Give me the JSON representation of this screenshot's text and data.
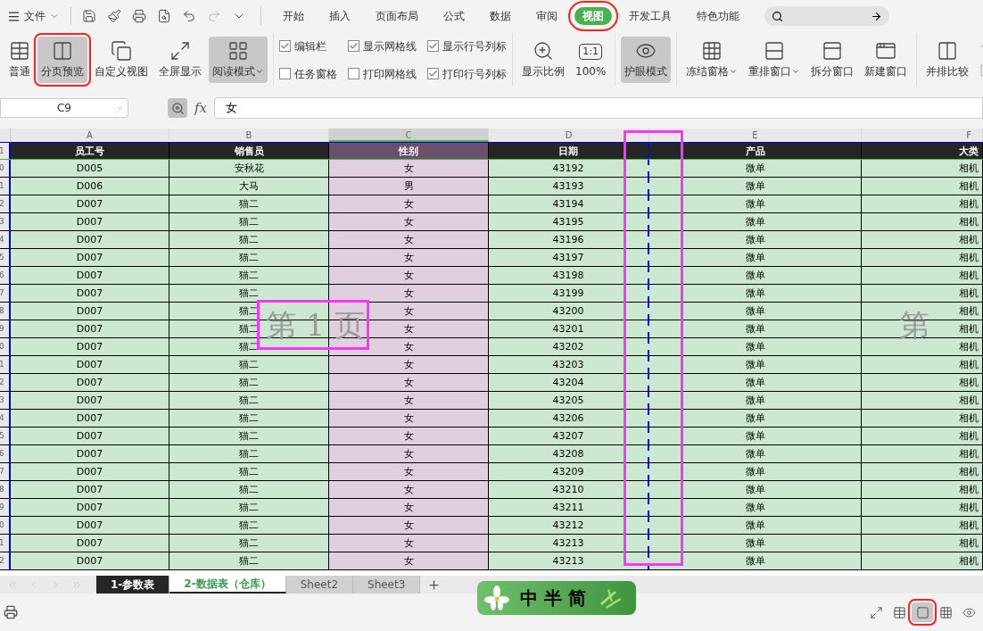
{
  "file_menu": {
    "label": "文件"
  },
  "tabs": [
    {
      "label": "开始",
      "selected": false,
      "annotated": false
    },
    {
      "label": "插入",
      "selected": false,
      "annotated": false
    },
    {
      "label": "页面布局",
      "selected": false,
      "annotated": false
    },
    {
      "label": "公式",
      "selected": false,
      "annotated": false
    },
    {
      "label": "数据",
      "selected": false,
      "annotated": false
    },
    {
      "label": "审阅",
      "selected": false,
      "annotated": false
    },
    {
      "label": "视图",
      "selected": true,
      "annotated": true
    },
    {
      "label": "开发工具",
      "selected": false,
      "annotated": false
    },
    {
      "label": "特色功能",
      "selected": false,
      "annotated": false
    }
  ],
  "ribbon_groups": [
    {
      "items": [
        {
          "kind": "large",
          "label": "普通",
          "pressed": false,
          "annotated": false,
          "dropdown": false
        },
        {
          "kind": "large",
          "label": "分页预览",
          "pressed": true,
          "annotated": true,
          "dropdown": false
        },
        {
          "kind": "large",
          "label": "自定义视图",
          "pressed": false,
          "annotated": false,
          "dropdown": false
        },
        {
          "kind": "large",
          "label": "全屏显示",
          "pressed": false,
          "annotated": false,
          "dropdown": false
        },
        {
          "kind": "large",
          "label": "阅读模式",
          "pressed": true,
          "annotated": false,
          "dropdown": true
        }
      ]
    },
    {
      "items": [
        {
          "kind": "check",
          "label": "编辑栏",
          "checked": true
        },
        {
          "kind": "check",
          "label": "任务窗格",
          "checked": false
        },
        {
          "kind": "check",
          "label": "显示网格线",
          "checked": true
        },
        {
          "kind": "check",
          "label": "打印网格线",
          "checked": false
        },
        {
          "kind": "check",
          "label": "显示行号列标",
          "checked": true
        },
        {
          "kind": "check",
          "label": "打印行号列标",
          "checked": true
        }
      ]
    },
    {
      "items": [
        {
          "kind": "large",
          "label": "显示比例",
          "pressed": false,
          "annotated": false,
          "dropdown": false
        },
        {
          "kind": "large",
          "label": "100%",
          "badge": "1:1",
          "pressed": false,
          "annotated": false,
          "dropdown": false
        }
      ]
    },
    {
      "items": [
        {
          "kind": "large",
          "label": "护眼模式",
          "pressed": true,
          "annotated": false,
          "dropdown": false
        }
      ]
    },
    {
      "items": [
        {
          "kind": "large",
          "label": "冻结窗格",
          "pressed": false,
          "annotated": false,
          "dropdown": true
        },
        {
          "kind": "large",
          "label": "重排窗口",
          "pressed": false,
          "annotated": false,
          "dropdown": true
        },
        {
          "kind": "large",
          "label": "拆分窗口",
          "pressed": false,
          "annotated": false,
          "dropdown": false
        },
        {
          "kind": "large",
          "label": "新建窗口",
          "pressed": false,
          "annotated": false,
          "dropdown": false
        }
      ]
    },
    {
      "items": [
        {
          "kind": "large",
          "label": "并排比较",
          "pressed": false,
          "annotated": false,
          "dropdown": false
        }
      ]
    }
  ],
  "formula_bar": {
    "name_box": "C9",
    "function_label": "fx",
    "formula": "女"
  },
  "columns": [
    {
      "letter": "A",
      "selected": false
    },
    {
      "letter": "B",
      "selected": false
    },
    {
      "letter": "C",
      "selected": true
    },
    {
      "letter": "D",
      "selected": false
    },
    {
      "letter": "E",
      "selected": false
    },
    {
      "letter": "F",
      "selected": false
    }
  ],
  "header_row": {
    "row_number": "1",
    "cells": [
      "员工号",
      "销售员",
      "性别",
      "日期",
      "产品",
      "大类"
    ]
  },
  "rows": [
    {
      "row_number": "0",
      "cells": [
        "D005",
        "安秋花",
        "女",
        "43192",
        "微单",
        "相机"
      ]
    },
    {
      "row_number": "1",
      "cells": [
        "D006",
        "大马",
        "男",
        "43193",
        "微单",
        "相机"
      ]
    },
    {
      "row_number": "2",
      "cells": [
        "D007",
        "猫二",
        "女",
        "43194",
        "微单",
        "相机"
      ]
    },
    {
      "row_number": "3",
      "cells": [
        "D007",
        "猫二",
        "女",
        "43195",
        "微单",
        "相机"
      ]
    },
    {
      "row_number": "4",
      "cells": [
        "D007",
        "猫二",
        "女",
        "43196",
        "微单",
        "相机"
      ]
    },
    {
      "row_number": "5",
      "cells": [
        "D007",
        "猫二",
        "女",
        "43197",
        "微单",
        "相机"
      ]
    },
    {
      "row_number": "6",
      "cells": [
        "D007",
        "猫二",
        "女",
        "43198",
        "微单",
        "相机"
      ]
    },
    {
      "row_number": "7",
      "cells": [
        "D007",
        "猫二",
        "女",
        "43199",
        "微单",
        "相机"
      ]
    },
    {
      "row_number": "8",
      "cells": [
        "D007",
        "猫二",
        "女",
        "43200",
        "微单",
        "相机"
      ]
    },
    {
      "row_number": "9",
      "cells": [
        "D007",
        "猫二",
        "女",
        "43201",
        "微单",
        "相机"
      ]
    },
    {
      "row_number": "0",
      "cells": [
        "D007",
        "猫二",
        "女",
        "43202",
        "微单",
        "相机"
      ]
    },
    {
      "row_number": "1",
      "cells": [
        "D007",
        "猫二",
        "女",
        "43203",
        "微单",
        "相机"
      ]
    },
    {
      "row_number": "2",
      "cells": [
        "D007",
        "猫二",
        "女",
        "43204",
        "微单",
        "相机"
      ]
    },
    {
      "row_number": "3",
      "cells": [
        "D007",
        "猫二",
        "女",
        "43205",
        "微单",
        "相机"
      ]
    },
    {
      "row_number": "4",
      "cells": [
        "D007",
        "猫二",
        "女",
        "43206",
        "微单",
        "相机"
      ]
    },
    {
      "row_number": "5",
      "cells": [
        "D007",
        "猫二",
        "女",
        "43207",
        "微单",
        "相机"
      ]
    },
    {
      "row_number": "6",
      "cells": [
        "D007",
        "猫二",
        "女",
        "43208",
        "微单",
        "相机"
      ]
    },
    {
      "row_number": "7",
      "cells": [
        "D007",
        "猫二",
        "女",
        "43209",
        "微单",
        "相机"
      ]
    },
    {
      "row_number": "8",
      "cells": [
        "D007",
        "猫二",
        "女",
        "43210",
        "微单",
        "相机"
      ]
    },
    {
      "row_number": "9",
      "cells": [
        "D007",
        "猫二",
        "女",
        "43211",
        "微单",
        "相机"
      ]
    },
    {
      "row_number": "0",
      "cells": [
        "D007",
        "猫二",
        "女",
        "43212",
        "微单",
        "相机"
      ]
    },
    {
      "row_number": "1",
      "cells": [
        "D007",
        "猫二",
        "女",
        "43213",
        "微单",
        "相机"
      ]
    },
    {
      "row_number": "2",
      "cells": [
        "D007",
        "猫二",
        "女",
        "43213",
        "微单",
        "相机"
      ]
    }
  ],
  "page_labels": [
    {
      "text": "第 1 页",
      "annotated": true
    },
    {
      "text": "第",
      "annotated": false
    }
  ],
  "page_break": {
    "annotated": true
  },
  "sheet_tabs": [
    {
      "label": "1-参数表",
      "selected": false,
      "color": "#262626"
    },
    {
      "label": "2-数据表（仓库）",
      "selected": true,
      "color": "#ffffff"
    },
    {
      "label": "Sheet2",
      "selected": false,
      "color": "#d0d0d0"
    },
    {
      "label": "Sheet3",
      "selected": false,
      "color": "#d0d0d0"
    }
  ],
  "input_method": {
    "text": "中 半 简"
  },
  "view_buttons": [
    {
      "selected": false,
      "annotated": false
    },
    {
      "selected": false,
      "annotated": false
    },
    {
      "selected": true,
      "annotated": true
    },
    {
      "selected": false,
      "annotated": false
    },
    {
      "selected": false,
      "annotated": false
    }
  ]
}
